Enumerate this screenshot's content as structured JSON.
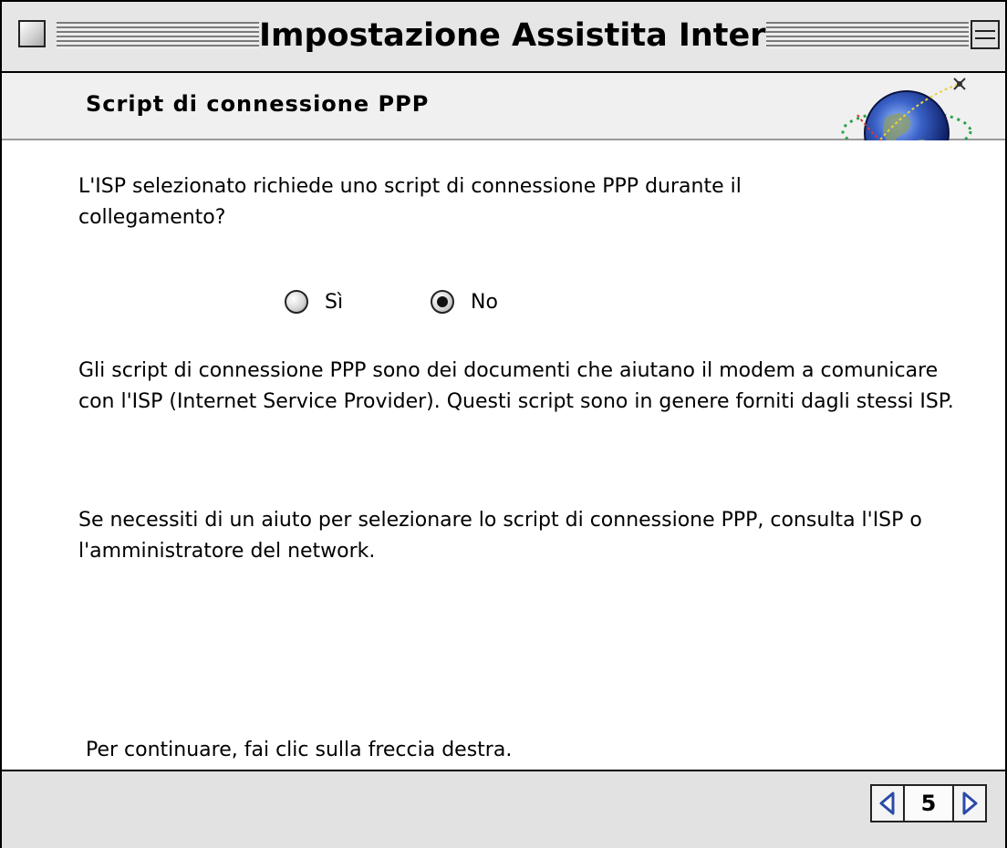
{
  "window": {
    "title": "Impostazione Assistita Internet"
  },
  "header": {
    "section_title": "Script di connessione PPP",
    "logo_icon": "globe-icon"
  },
  "content": {
    "question": "L'ISP selezionato richiede uno script di connessione PPP durante il collegamento?",
    "radio_options": [
      {
        "label": "Sì",
        "checked": false
      },
      {
        "label": "No",
        "checked": true
      }
    ],
    "explanation": "Gli script di connessione PPP sono dei documenti che aiutano il modem a comunicare con l'ISP (Internet Service Provider). Questi script sono in genere forniti dagli stessi ISP.",
    "help_text": "Se necessiti di un aiuto per selezionare lo script di connessione PPP, consulta l'ISP o l'amministratore del network.",
    "continue_hint": "Per continuare, fai clic sulla freccia destra."
  },
  "footer": {
    "page_number": "5",
    "prev_icon": "left-arrow-icon",
    "next_icon": "right-arrow-icon",
    "arrow_color": "#2a4aa8"
  }
}
